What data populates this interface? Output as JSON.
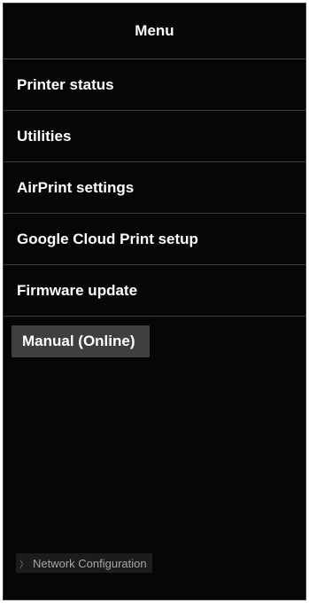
{
  "header": {
    "title": "Menu"
  },
  "menu": {
    "items": [
      {
        "label": "Printer status"
      },
      {
        "label": "Utilities"
      },
      {
        "label": "AirPrint settings"
      },
      {
        "label": "Google Cloud Print setup"
      },
      {
        "label": "Firmware update"
      }
    ],
    "manual_label": "Manual (Online)"
  },
  "footer": {
    "network_configuration_label": "Network Configuration",
    "chevron_icon": "chevron-right-icon"
  },
  "colors": {
    "background": "#060606",
    "text": "#ffffff",
    "button_background": "#3f3f3f",
    "footer_text": "#a6a6a6"
  }
}
